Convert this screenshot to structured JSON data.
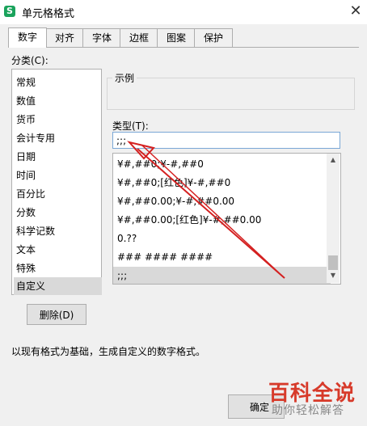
{
  "window": {
    "title": "单元格格式",
    "close_glyph": "✕",
    "app_icon_glyph": "S"
  },
  "tabs": [
    {
      "label": "数字"
    },
    {
      "label": "对齐"
    },
    {
      "label": "字体"
    },
    {
      "label": "边框"
    },
    {
      "label": "图案"
    },
    {
      "label": "保护"
    }
  ],
  "category": {
    "label": "分类(C):",
    "items": [
      "常规",
      "数值",
      "货币",
      "会计专用",
      "日期",
      "时间",
      "百分比",
      "分数",
      "科学记数",
      "文本",
      "特殊",
      "自定义"
    ],
    "selected": "自定义"
  },
  "sample": {
    "label": "示例"
  },
  "type": {
    "label": "类型(T):",
    "value": ";;;",
    "list": [
      "¥#,##0;¥-#,##0",
      "¥#,##0;[红色]¥-#,##0",
      "¥#,##0.00;¥-#,##0.00",
      "¥#,##0.00;[红色]¥-#,##0.00",
      "0.??",
      "### #### ####",
      ";;;"
    ]
  },
  "buttons": {
    "delete": "删除(D)",
    "ok": "确定"
  },
  "description": "以现有格式为基础，生成自定义的数字格式。",
  "watermark": {
    "main": "百科全说",
    "sub": "助你轻松解答"
  },
  "colors": {
    "annotation_arrow": "#d42020",
    "app_icon": "#1aa35c"
  }
}
